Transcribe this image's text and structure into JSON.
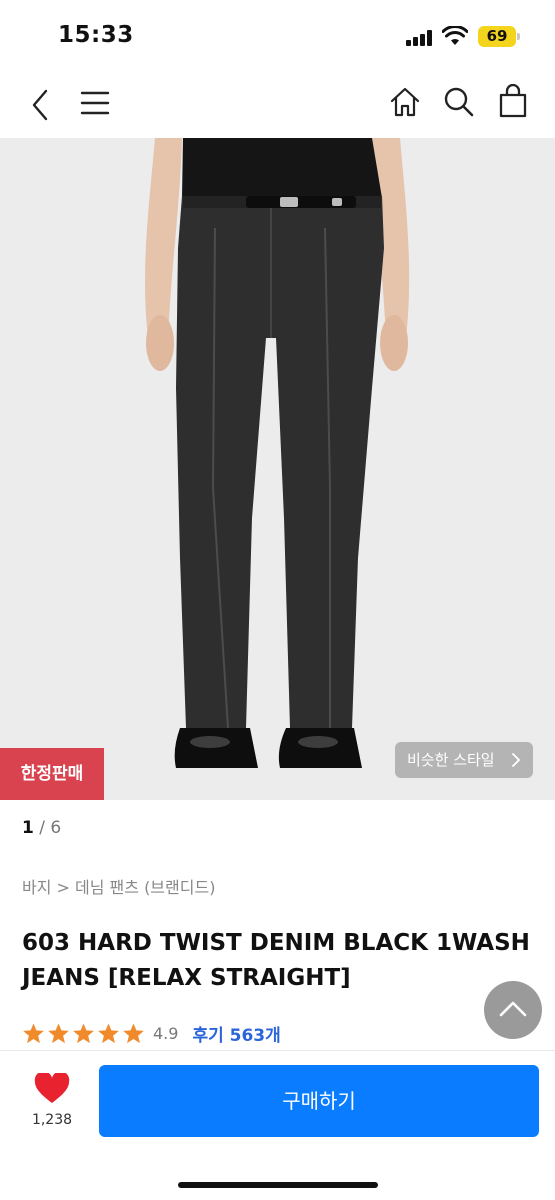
{
  "status_bar": {
    "time": "15:33",
    "battery": "69",
    "icons": [
      "signal-icon",
      "wifi-icon",
      "battery-icon"
    ]
  },
  "nav": {
    "icons": [
      "back-icon",
      "menu-icon",
      "home-icon",
      "search-icon",
      "bag-icon"
    ]
  },
  "hero": {
    "badge_label": "한정판매",
    "similar_style_label": "비슷한 스타일"
  },
  "pager": {
    "current": "1",
    "separator": " / ",
    "total": "6"
  },
  "breadcrumb": "바지 > 데님 팬츠 (브랜디드)",
  "product": {
    "title": "603 HARD TWIST DENIM BLACK 1WASH JEANS [RELAX STRAIGHT]",
    "rating": "4.9",
    "stars": 5,
    "reviews_label": "후기 563개"
  },
  "bottom_bar": {
    "like_count": "1,238",
    "buy_label": "구매하기"
  },
  "colors": {
    "accent": "#0a7cff",
    "badge": "#d8434f",
    "star": "#f08a2a",
    "heart": "#e8232f",
    "review_link": "#2b65d9"
  }
}
